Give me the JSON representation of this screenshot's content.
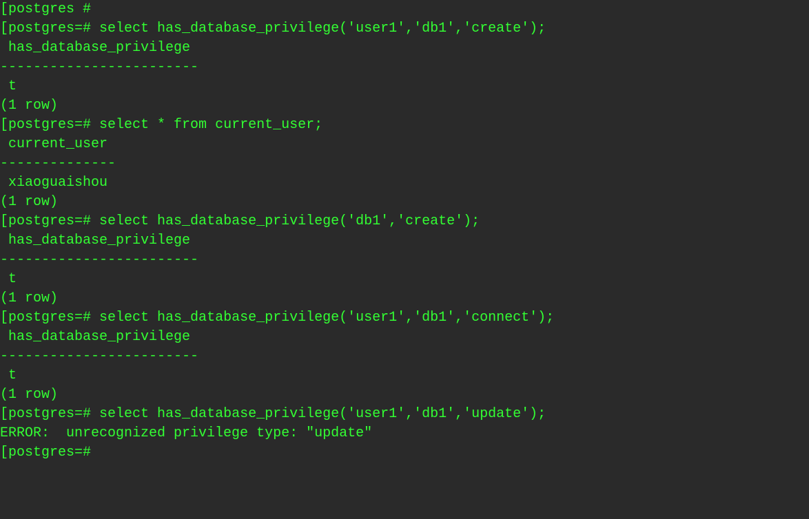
{
  "terminal": {
    "lines": [
      {
        "bracket": "[",
        "text": "postgres #"
      },
      {
        "bracket": "[",
        "text": "postgres=# select has_database_privilege('user1','db1','create');"
      },
      {
        "bracket": "",
        "text": " has_database_privilege"
      },
      {
        "bracket": "",
        "text": "------------------------"
      },
      {
        "bracket": "",
        "text": " t"
      },
      {
        "bracket": "",
        "text": "(1 row)"
      },
      {
        "bracket": "",
        "text": ""
      },
      {
        "bracket": "[",
        "text": "postgres=# select * from current_user;"
      },
      {
        "bracket": "",
        "text": " current_user"
      },
      {
        "bracket": "",
        "text": "--------------"
      },
      {
        "bracket": "",
        "text": " xiaoguaishou"
      },
      {
        "bracket": "",
        "text": "(1 row)"
      },
      {
        "bracket": "",
        "text": ""
      },
      {
        "bracket": "[",
        "text": "postgres=# select has_database_privilege('db1','create');"
      },
      {
        "bracket": "",
        "text": " has_database_privilege"
      },
      {
        "bracket": "",
        "text": "------------------------"
      },
      {
        "bracket": "",
        "text": " t"
      },
      {
        "bracket": "",
        "text": "(1 row)"
      },
      {
        "bracket": "",
        "text": ""
      },
      {
        "bracket": "[",
        "text": "postgres=# select has_database_privilege('user1','db1','connect');"
      },
      {
        "bracket": "",
        "text": " has_database_privilege"
      },
      {
        "bracket": "",
        "text": "------------------------"
      },
      {
        "bracket": "",
        "text": " t"
      },
      {
        "bracket": "",
        "text": "(1 row)"
      },
      {
        "bracket": "",
        "text": ""
      },
      {
        "bracket": "[",
        "text": "postgres=# select has_database_privilege('user1','db1','update');"
      },
      {
        "bracket": "",
        "text": "ERROR:  unrecognized privilege type: \"update\""
      },
      {
        "bracket": "[",
        "text": "postgres=#"
      }
    ]
  }
}
